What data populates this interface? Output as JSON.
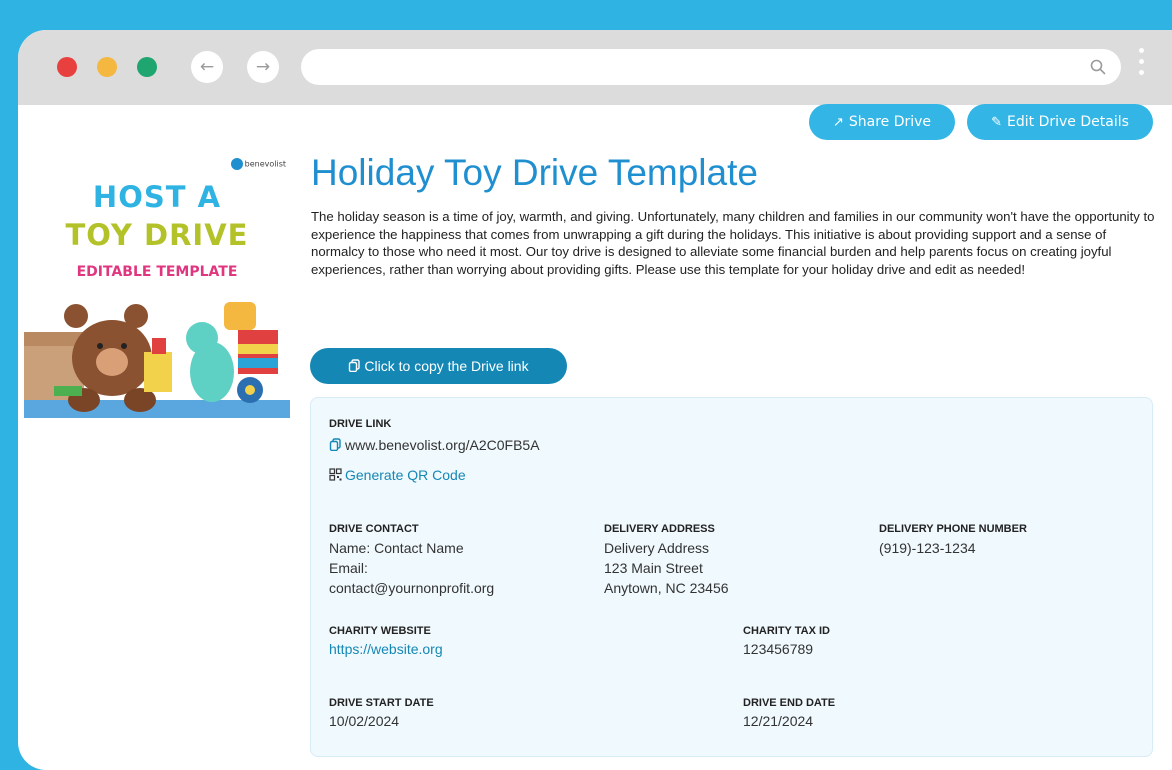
{
  "toolbar": {
    "share_label": "Share Drive",
    "edit_label": "Edit Drive Details"
  },
  "thumbnail": {
    "logo_text": "benevolist",
    "line1": "HOST A",
    "line2": "TOY DRIVE",
    "line3": "EDITABLE TEMPLATE"
  },
  "page": {
    "title": "Holiday Toy Drive Template",
    "description": "The holiday season is a time of joy, warmth, and giving. Unfortunately, many children and families in our community won't have the opportunity to experience the happiness that comes from unwrapping a gift during the holidays. This initiative is about providing support and a sense of normalcy to those who need it most. Our toy drive is designed to alleviate some financial burden and help parents focus on creating joyful experiences, rather than worrying about providing gifts. Please use this template for your holiday drive and edit as needed!",
    "copy_button": "Click to copy the Drive link"
  },
  "details": {
    "drive_link_label": "DRIVE LINK",
    "drive_link": "www.benevolist.org/A2C0FB5A",
    "qr_label": "Generate QR Code",
    "contact_label": "DRIVE CONTACT",
    "contact_name": "Name: Contact Name",
    "contact_email_label": "Email:",
    "contact_email": "contact@yournonprofit.org",
    "address_label": "DELIVERY ADDRESS",
    "address_line1": "Delivery Address",
    "address_line2": "123 Main Street",
    "address_line3": "Anytown, NC 23456",
    "phone_label": "DELIVERY PHONE NUMBER",
    "phone": "(919)-123-1234",
    "website_label": "CHARITY WEBSITE",
    "website": "https://website.org",
    "tax_label": "CHARITY TAX ID",
    "tax_id": "123456789",
    "start_label": "DRIVE START DATE",
    "start_date": "10/02/2024",
    "end_label": "DRIVE END DATE",
    "end_date": "12/21/2024"
  },
  "colors": {
    "background": "#2eb3e3",
    "accent": "#33b6e6",
    "title": "#1f8fcf",
    "primary_button": "#1587b5"
  }
}
